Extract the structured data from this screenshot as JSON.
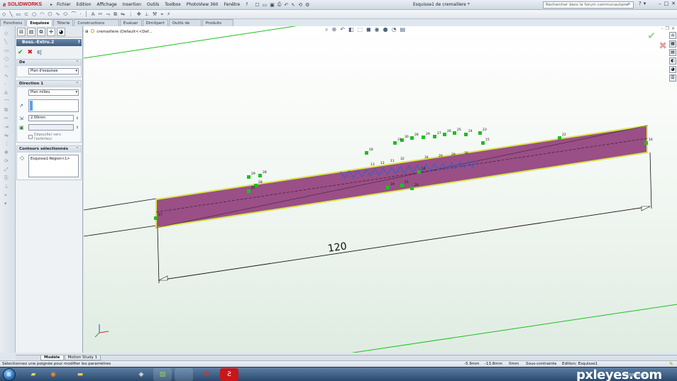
{
  "app": {
    "logo_text": "SOLIDWORKS",
    "document_title": "Esquisse1 de cremaillere *"
  },
  "menu": {
    "items": [
      "Fichier",
      "Edition",
      "Affichage",
      "Insertion",
      "Outils",
      "Toolbox",
      "PhotoView 360",
      "Fenêtre"
    ],
    "more": "?"
  },
  "search": {
    "placeholder": "Rechercher dans le forum communautaire"
  },
  "command_tabs": [
    "Fonctions",
    "Esquisse",
    "Tôlerie",
    "Constructions soudées",
    "Evaluer",
    "DimXpert",
    "Outils de rendu",
    "Produits Office"
  ],
  "property_manager": {
    "title": "Boss.-Extru.2",
    "help": "?",
    "from_group": {
      "label": "De",
      "value": "Plan d'esquisse"
    },
    "direction_group": {
      "label": "Direction 1",
      "end_condition": "Plan milieu",
      "depth": "2.00mm",
      "draft_label": "Dépouiller vers l'extérieur"
    },
    "contours_group": {
      "label": "Contours sélectionnés",
      "item": "Esquisse1-Région<1>"
    }
  },
  "viewport": {
    "tree_label": "cremaillere  (Default<<Def...",
    "dimension": "120",
    "dimension_length": 120,
    "relation_labels": [
      "29",
      "28",
      "27",
      "28",
      "31",
      "30",
      "28",
      "29",
      "27",
      "26",
      "25",
      "24",
      "23",
      "22",
      "21",
      "20",
      "19",
      "18",
      "17",
      "16",
      "15",
      "14",
      "13",
      "12",
      "11",
      "32",
      "34",
      "20",
      "29",
      "30"
    ]
  },
  "model_tabs": [
    "Modèle",
    "Motion Study 1"
  ],
  "status": {
    "message": "Sélectionnez une poignée pour modifier les paramètres",
    "x": "-5.9mm",
    "y": "-13.8mm",
    "z": "0mm",
    "state": "Sous-contrainte",
    "edit": "Edition: Esquisse1"
  },
  "taskbar": {
    "clock": "20/06/2012",
    "watermark": "pxleyes.com"
  },
  "colors": {
    "rack_fill": "#9a4f86",
    "rack_border": "#d8e64c",
    "accent_green": "#1fbf1f"
  }
}
